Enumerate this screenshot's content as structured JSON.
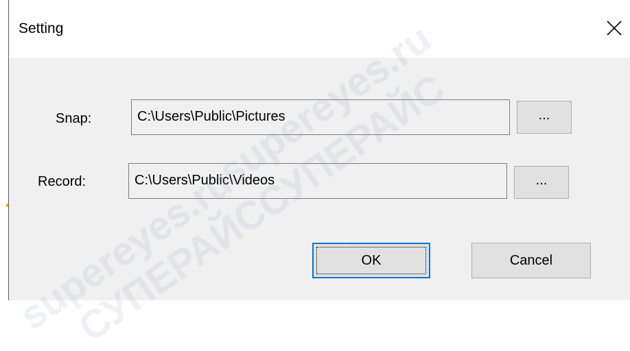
{
  "dialog": {
    "title": "Setting"
  },
  "snap": {
    "label": "Snap:",
    "path": "C:\\Users\\Public\\Pictures",
    "browse_label": "..."
  },
  "record": {
    "label": "Record:",
    "path": "C:\\Users\\Public\\Videos",
    "browse_label": "..."
  },
  "buttons": {
    "ok_label": "OK",
    "cancel_label": "Cancel"
  },
  "watermarks": [
    "supereyes.ru",
    "СУПЕРАЙС",
    "supereyes.ru",
    "СУПЕРАЙС"
  ]
}
